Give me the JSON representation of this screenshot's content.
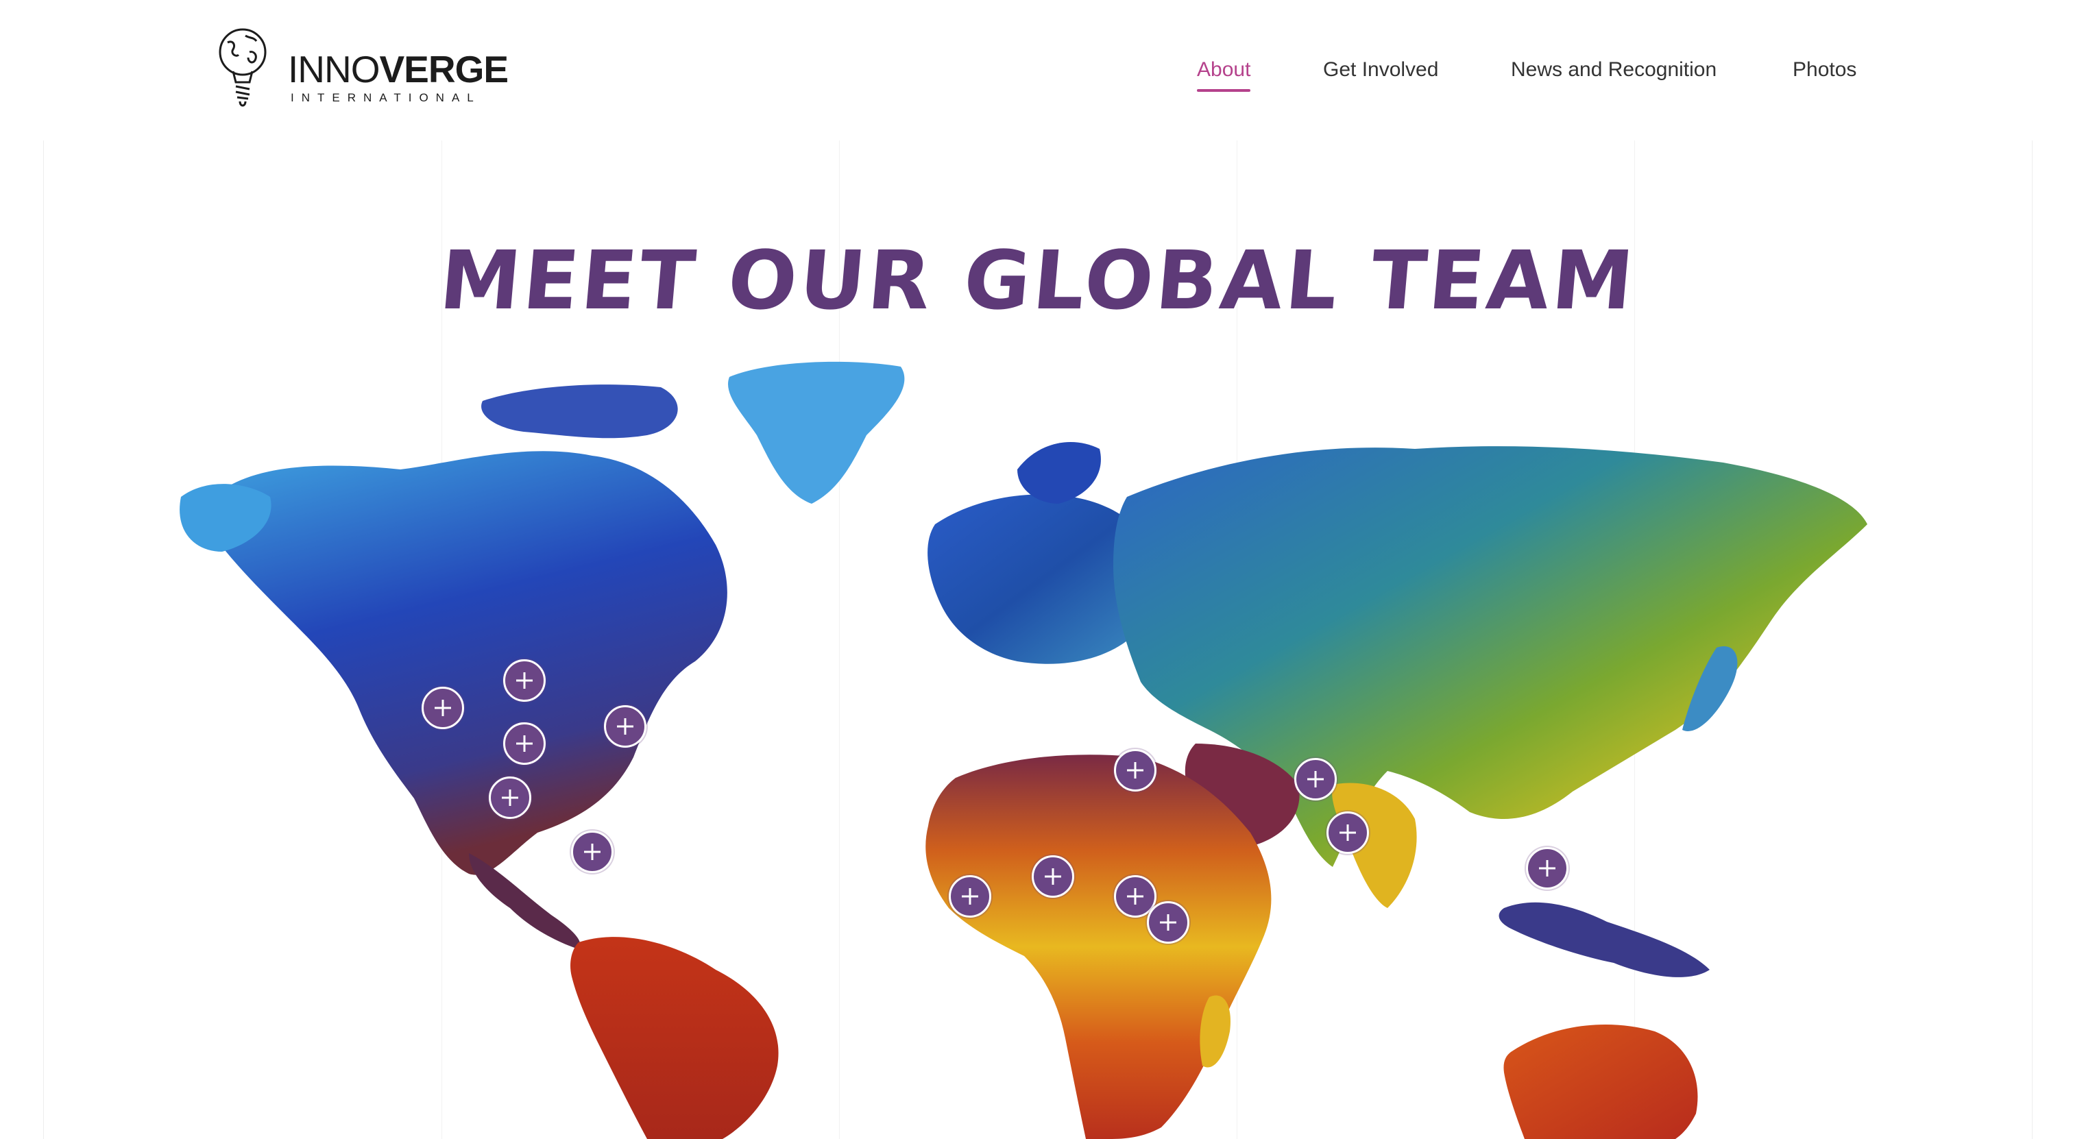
{
  "brand": {
    "name_light": "INNO",
    "name_bold": "VERGE",
    "tagline": "INTERNATIONAL",
    "icon": "lightbulb-globe-icon"
  },
  "nav": {
    "items": [
      {
        "label": "About",
        "active": true
      },
      {
        "label": "Get Involved",
        "active": false
      },
      {
        "label": "News and Recognition",
        "active": false
      },
      {
        "label": "Photos",
        "active": false
      }
    ]
  },
  "main": {
    "title": "MEET OUR GLOBAL TEAM",
    "map_icon": "world-map-watercolor",
    "marker_icon": "plus-icon"
  },
  "colors": {
    "accent": "#b5428c",
    "marker": "#6a4585",
    "title": "#5e3a78"
  }
}
